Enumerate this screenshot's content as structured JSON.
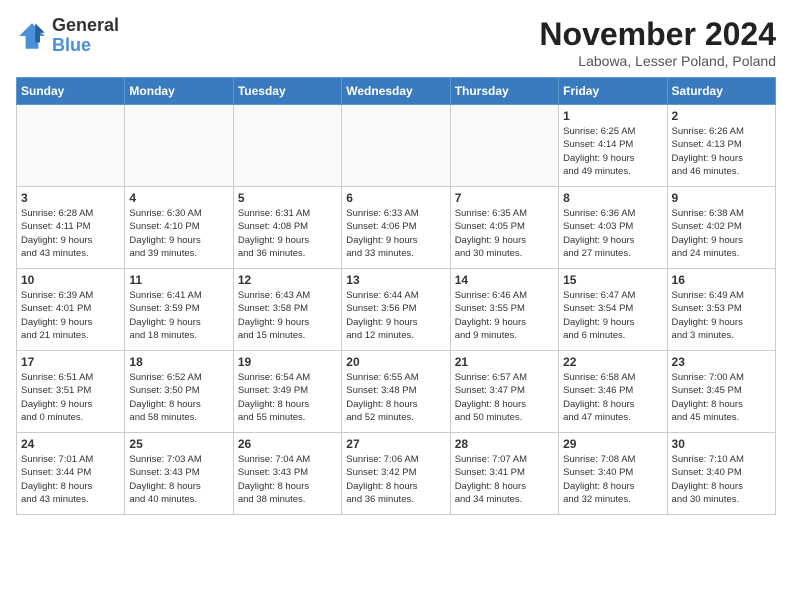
{
  "header": {
    "logo_line1": "General",
    "logo_line2": "Blue",
    "month": "November 2024",
    "location": "Labowa, Lesser Poland, Poland"
  },
  "weekdays": [
    "Sunday",
    "Monday",
    "Tuesday",
    "Wednesday",
    "Thursday",
    "Friday",
    "Saturday"
  ],
  "weeks": [
    [
      {
        "day": "",
        "info": ""
      },
      {
        "day": "",
        "info": ""
      },
      {
        "day": "",
        "info": ""
      },
      {
        "day": "",
        "info": ""
      },
      {
        "day": "",
        "info": ""
      },
      {
        "day": "1",
        "info": "Sunrise: 6:25 AM\nSunset: 4:14 PM\nDaylight: 9 hours\nand 49 minutes."
      },
      {
        "day": "2",
        "info": "Sunrise: 6:26 AM\nSunset: 4:13 PM\nDaylight: 9 hours\nand 46 minutes."
      }
    ],
    [
      {
        "day": "3",
        "info": "Sunrise: 6:28 AM\nSunset: 4:11 PM\nDaylight: 9 hours\nand 43 minutes."
      },
      {
        "day": "4",
        "info": "Sunrise: 6:30 AM\nSunset: 4:10 PM\nDaylight: 9 hours\nand 39 minutes."
      },
      {
        "day": "5",
        "info": "Sunrise: 6:31 AM\nSunset: 4:08 PM\nDaylight: 9 hours\nand 36 minutes."
      },
      {
        "day": "6",
        "info": "Sunrise: 6:33 AM\nSunset: 4:06 PM\nDaylight: 9 hours\nand 33 minutes."
      },
      {
        "day": "7",
        "info": "Sunrise: 6:35 AM\nSunset: 4:05 PM\nDaylight: 9 hours\nand 30 minutes."
      },
      {
        "day": "8",
        "info": "Sunrise: 6:36 AM\nSunset: 4:03 PM\nDaylight: 9 hours\nand 27 minutes."
      },
      {
        "day": "9",
        "info": "Sunrise: 6:38 AM\nSunset: 4:02 PM\nDaylight: 9 hours\nand 24 minutes."
      }
    ],
    [
      {
        "day": "10",
        "info": "Sunrise: 6:39 AM\nSunset: 4:01 PM\nDaylight: 9 hours\nand 21 minutes."
      },
      {
        "day": "11",
        "info": "Sunrise: 6:41 AM\nSunset: 3:59 PM\nDaylight: 9 hours\nand 18 minutes."
      },
      {
        "day": "12",
        "info": "Sunrise: 6:43 AM\nSunset: 3:58 PM\nDaylight: 9 hours\nand 15 minutes."
      },
      {
        "day": "13",
        "info": "Sunrise: 6:44 AM\nSunset: 3:56 PM\nDaylight: 9 hours\nand 12 minutes."
      },
      {
        "day": "14",
        "info": "Sunrise: 6:46 AM\nSunset: 3:55 PM\nDaylight: 9 hours\nand 9 minutes."
      },
      {
        "day": "15",
        "info": "Sunrise: 6:47 AM\nSunset: 3:54 PM\nDaylight: 9 hours\nand 6 minutes."
      },
      {
        "day": "16",
        "info": "Sunrise: 6:49 AM\nSunset: 3:53 PM\nDaylight: 9 hours\nand 3 minutes."
      }
    ],
    [
      {
        "day": "17",
        "info": "Sunrise: 6:51 AM\nSunset: 3:51 PM\nDaylight: 9 hours\nand 0 minutes."
      },
      {
        "day": "18",
        "info": "Sunrise: 6:52 AM\nSunset: 3:50 PM\nDaylight: 8 hours\nand 58 minutes."
      },
      {
        "day": "19",
        "info": "Sunrise: 6:54 AM\nSunset: 3:49 PM\nDaylight: 8 hours\nand 55 minutes."
      },
      {
        "day": "20",
        "info": "Sunrise: 6:55 AM\nSunset: 3:48 PM\nDaylight: 8 hours\nand 52 minutes."
      },
      {
        "day": "21",
        "info": "Sunrise: 6:57 AM\nSunset: 3:47 PM\nDaylight: 8 hours\nand 50 minutes."
      },
      {
        "day": "22",
        "info": "Sunrise: 6:58 AM\nSunset: 3:46 PM\nDaylight: 8 hours\nand 47 minutes."
      },
      {
        "day": "23",
        "info": "Sunrise: 7:00 AM\nSunset: 3:45 PM\nDaylight: 8 hours\nand 45 minutes."
      }
    ],
    [
      {
        "day": "24",
        "info": "Sunrise: 7:01 AM\nSunset: 3:44 PM\nDaylight: 8 hours\nand 43 minutes."
      },
      {
        "day": "25",
        "info": "Sunrise: 7:03 AM\nSunset: 3:43 PM\nDaylight: 8 hours\nand 40 minutes."
      },
      {
        "day": "26",
        "info": "Sunrise: 7:04 AM\nSunset: 3:43 PM\nDaylight: 8 hours\nand 38 minutes."
      },
      {
        "day": "27",
        "info": "Sunrise: 7:06 AM\nSunset: 3:42 PM\nDaylight: 8 hours\nand 36 minutes."
      },
      {
        "day": "28",
        "info": "Sunrise: 7:07 AM\nSunset: 3:41 PM\nDaylight: 8 hours\nand 34 minutes."
      },
      {
        "day": "29",
        "info": "Sunrise: 7:08 AM\nSunset: 3:40 PM\nDaylight: 8 hours\nand 32 minutes."
      },
      {
        "day": "30",
        "info": "Sunrise: 7:10 AM\nSunset: 3:40 PM\nDaylight: 8 hours\nand 30 minutes."
      }
    ]
  ]
}
